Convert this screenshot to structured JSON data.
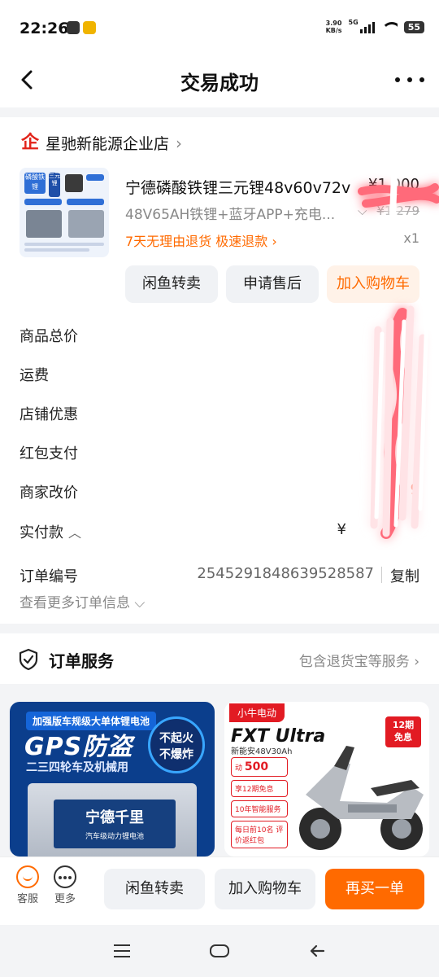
{
  "status_bar": {
    "time": "22:26",
    "net_speed_value": "3.90",
    "net_speed_unit": "KB/s",
    "signal_label": "5G",
    "battery": "55"
  },
  "header": {
    "title": "交易成功"
  },
  "shop": {
    "logo_text": "企",
    "name": "星驰新能源企业店",
    "chevron": "›"
  },
  "product": {
    "title": "宁德磷酸铁锂三元锂48v60v72v",
    "price": "¥1,000",
    "spec": "48V65AH铁锂+蓝牙APP+充电...",
    "original_price": "¥1,279",
    "return_policy": "7天无理由退货  极速退款 ›",
    "quantity": "x1",
    "thumb_texts": [
      "磷酸铁锂",
      "三元锂"
    ]
  },
  "actions": {
    "resell": "闲鱼转卖",
    "after_sales": "申请售后",
    "add_cart": "加入购物车"
  },
  "fees": [
    {
      "label": "商品总价",
      "value": ""
    },
    {
      "label": "运费",
      "value": ""
    },
    {
      "label": "店铺优惠",
      "value": ""
    },
    {
      "label": "红包支付",
      "value": ""
    },
    {
      "label": "商家改价",
      "value": "¥ 9"
    },
    {
      "label": "实付款",
      "value": "¥"
    }
  ],
  "order": {
    "number_label": "订单编号",
    "number": "2545291848639528587",
    "copy": "复制",
    "more_info": "查看更多订单信息 ⌵"
  },
  "service": {
    "title": "订单服务",
    "desc": "包含退货宝等服务 ›"
  },
  "banner_left": {
    "tag": "加强版车规级大单体锂电池",
    "headline": "GPS防盗",
    "sub": "二三四轮车及机械用",
    "circle_line1": "不起火",
    "circle_line2": "不爆炸",
    "battery_brand": "宁德千里",
    "battery_desc": "汽车级动力锂电池"
  },
  "banner_right": {
    "brand": "小牛电动",
    "model_title": "FXT Ultra",
    "model_sub": "新能安48V30Ah",
    "badge_line1": "12期",
    "badge_line2": "免息",
    "perk1_prefix": "动",
    "perk1_value": "500",
    "perk2": "享12期免息",
    "perk3": "10年智能服务",
    "perk4": "每日前10名 评价返红包"
  },
  "bottom_bar": {
    "service_label": "客服",
    "more_label": "更多",
    "resell": "闲鱼转卖",
    "add_cart": "加入购物车",
    "rebuy": "再买一单"
  },
  "colors": {
    "accent": "#ff6a00",
    "price_red": "#ff5533",
    "brand_red": "#e2231a"
  }
}
